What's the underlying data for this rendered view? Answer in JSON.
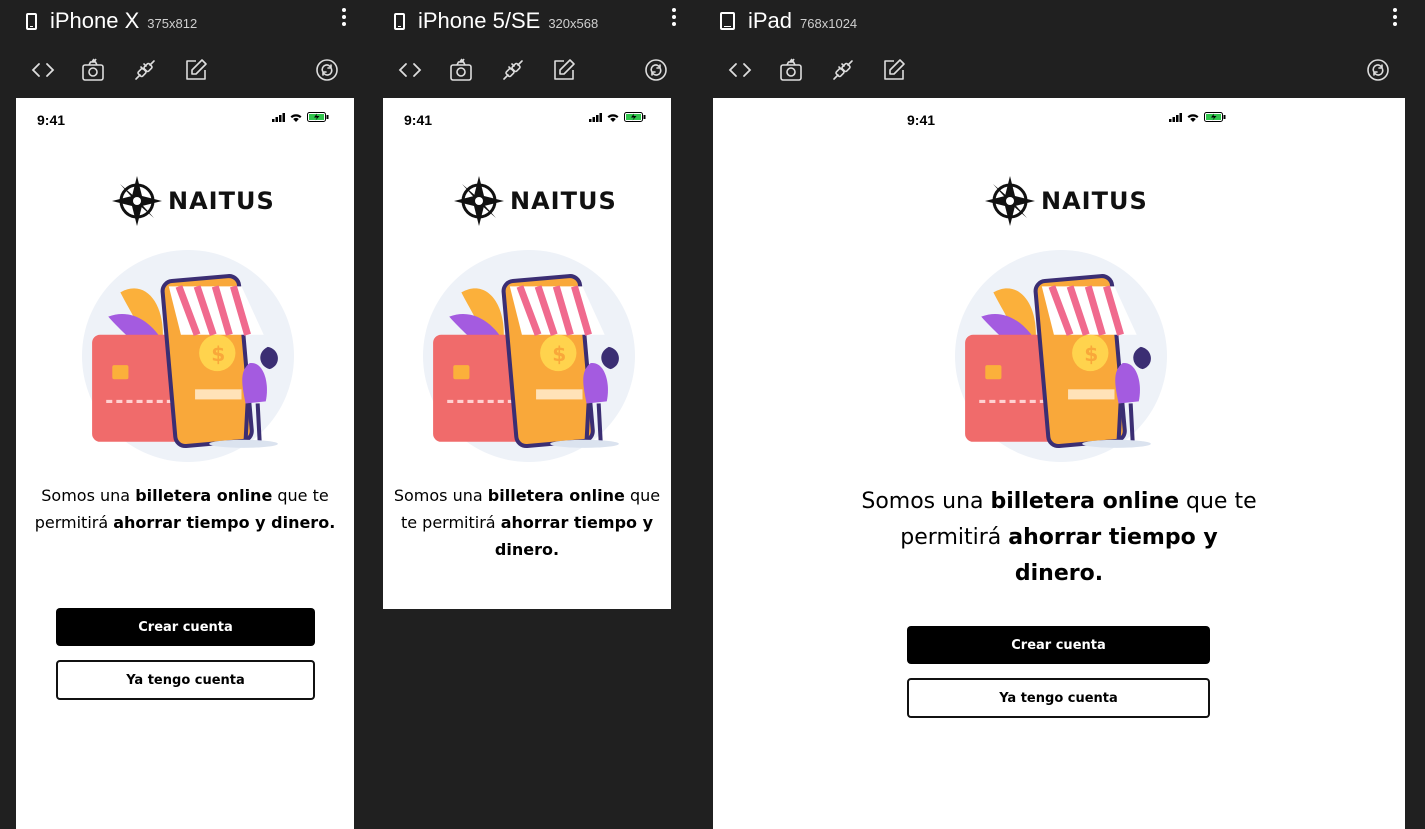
{
  "panels": [
    {
      "device": "iPhone X",
      "size": "375x812",
      "time": "9:41",
      "logo": "NAITUS",
      "tagline": {
        "p1": "Somos una ",
        "b1": "billetera online",
        "p2": " que te permitirá ",
        "b2": "ahorrar tiempo y dinero."
      },
      "buttons": {
        "create": "Crear cuenta",
        "login": "Ya tengo cuenta"
      }
    },
    {
      "device": "iPhone 5/SE",
      "size": "320x568",
      "time": "9:41",
      "logo": "NAITUS",
      "tagline": {
        "p1": "Somos una ",
        "b1": "billetera online",
        "p2": " que te permitirá ",
        "b2": "ahorrar tiempo y dinero."
      }
    },
    {
      "device": "iPad",
      "size": "768x1024",
      "time": "9:41",
      "logo": "NAITUS",
      "tagline": {
        "p1": "Somos una ",
        "b1": "billetera online",
        "p2": " que te permitirá ",
        "b2": "ahorrar tiempo y dinero."
      },
      "buttons": {
        "create": "Crear cuenta",
        "login": "Ya tengo cuenta"
      }
    }
  ],
  "icons": [
    "code-icon",
    "screenshot-icon",
    "connect-icon",
    "edit-icon",
    "rotate-icon",
    "more-vert-icon",
    "phone-device-icon",
    "tablet-device-icon",
    "signal-icon",
    "wifi-icon",
    "battery-icon"
  ],
  "colors": {
    "background": "#202020",
    "screen": "#ffffff",
    "button_dark": "#000000",
    "card": "#f06b6b",
    "phone": "#fbb03b",
    "awning": "#f06a8e"
  }
}
